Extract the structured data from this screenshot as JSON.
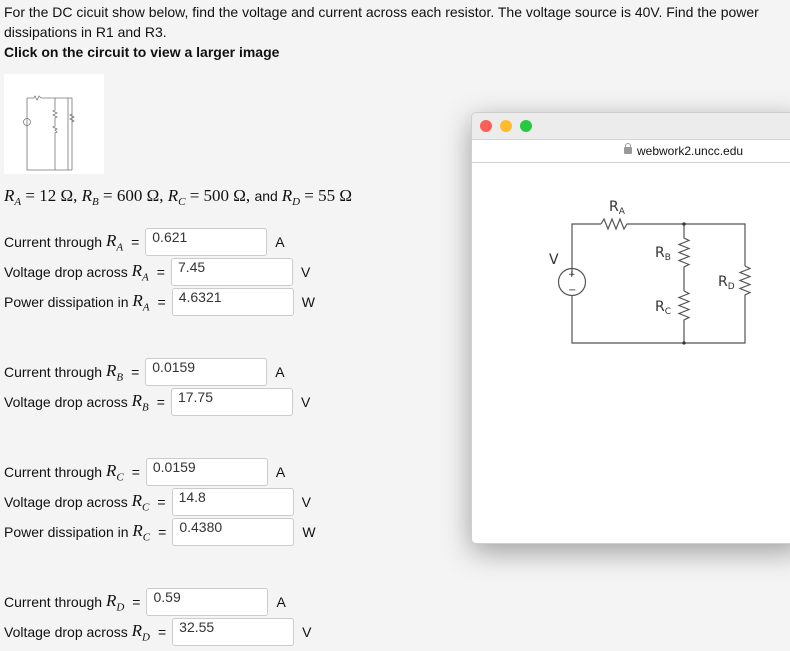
{
  "intro": {
    "line1": "For the DC cicuit show below, find the voltage and current across each resistor. The voltage source is 40V. Find the power dissipations in R1 and R3.",
    "click_hint": "Click on the circuit to view a larger image"
  },
  "given": {
    "text_parts": [
      "R",
      "A",
      " = 12 Ω, ",
      "R",
      "B",
      " = 600 Ω, ",
      "R",
      "C",
      " = 500 Ω, ",
      "and ",
      "R",
      "D",
      " = 55 Ω"
    ]
  },
  "rows": [
    {
      "label": "Current through",
      "sub": "A",
      "value": "0.621",
      "unit": "A"
    },
    {
      "label": "Voltage drop across",
      "sub": "A",
      "value": "7.45",
      "unit": "V"
    },
    {
      "label": "Power dissipation in",
      "sub": "A",
      "value": "4.6321",
      "unit": "W"
    },
    {
      "label": "Current through",
      "sub": "B",
      "value": "0.0159",
      "unit": "A"
    },
    {
      "label": "Voltage drop across",
      "sub": "B",
      "value": "17.75",
      "unit": "V"
    },
    {
      "label": "Current through",
      "sub": "C",
      "value": "0.0159",
      "unit": "A"
    },
    {
      "label": "Voltage drop across",
      "sub": "C",
      "value": "14.8",
      "unit": "V"
    },
    {
      "label": "Power dissipation in",
      "sub": "C",
      "value": "0.4380",
      "unit": "W"
    },
    {
      "label": "Current through",
      "sub": "D",
      "value": "0.59",
      "unit": "A"
    },
    {
      "label": "Voltage drop across",
      "sub": "D",
      "value": "32.55",
      "unit": "V"
    }
  ],
  "popup": {
    "url": "webwork2.uncc.edu",
    "colors": {
      "close": "#fc5f57",
      "min": "#fdbc2e",
      "max": "#28c840"
    },
    "labels": {
      "v": "V",
      "ra": "R",
      "rb": "R",
      "rc": "R",
      "rd": "R",
      "a": "A",
      "b": "B",
      "c": "C",
      "d": "D",
      "plus": "+",
      "minus": "−"
    }
  }
}
